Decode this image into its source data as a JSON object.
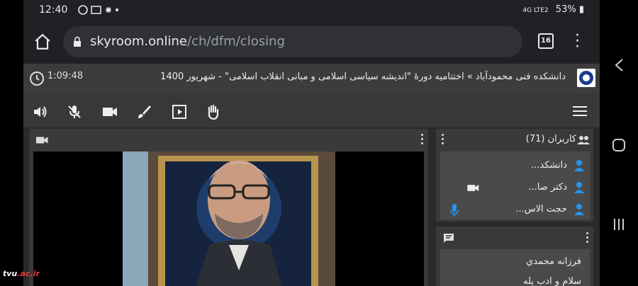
{
  "status": {
    "time": "12:40",
    "network": "4G LTE2",
    "battery": "53%"
  },
  "browser": {
    "domain": "skyroom.online",
    "path": "/ch/dfm/closing",
    "tab_count": "16"
  },
  "room": {
    "elapsed": "1:09:48",
    "title": "دانشکده فنی محمودآباد » اختتامیه دورهٔ \"اندیشه سیاسی اسلامی و مبانی انقلاب اسلامی\" - شهریور 1400"
  },
  "users": {
    "title": "کاربران (71)",
    "list": [
      {
        "name": "دانشکد..."
      },
      {
        "name": "دکتر صا..."
      },
      {
        "name": "حجت الاس..."
      }
    ]
  },
  "chat": {
    "lines": [
      "فرزانه محمدي",
      "سلام و ادب یله"
    ]
  },
  "watermark": {
    "prefix": "tvu",
    "suffix": ".ac.ir"
  },
  "colors": {
    "accent": "#2196f3",
    "user_icon": "#2196f3"
  }
}
